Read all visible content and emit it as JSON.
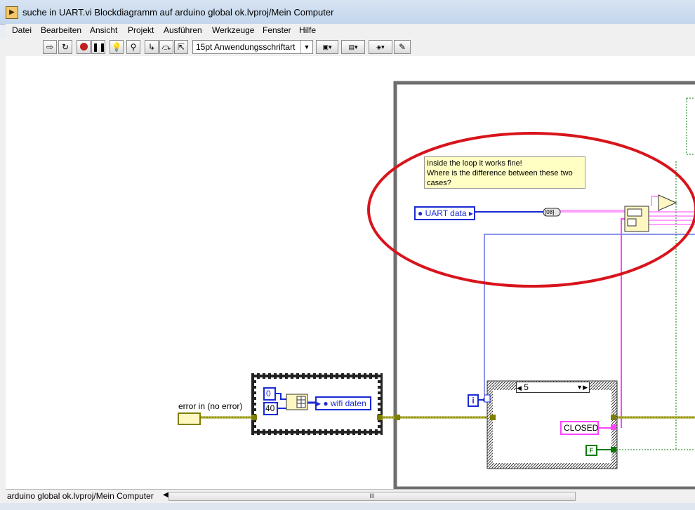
{
  "window": {
    "title": "suche in UART.vi Blockdiagramm auf arduino global ok.lvproj/Mein Computer",
    "app_icon": "labview-vi-icon"
  },
  "menu": [
    "Datei",
    "Bearbeiten",
    "Ansicht",
    "Projekt",
    "Ausführen",
    "Werkzeuge",
    "Fenster",
    "Hilfe"
  ],
  "toolbar": {
    "buttons": [
      "run-arrow-icon",
      "run-continuously-icon",
      "abort-icon",
      "pause-icon",
      "highlight-execution-icon",
      "retain-wire-values-icon",
      "step-into-icon",
      "step-over-icon",
      "step-out-icon"
    ],
    "font_selector": "15pt Anwendungsschriftart",
    "extra_buttons": [
      "align-objects-icon",
      "distribute-objects-icon",
      "reorder-icon",
      "clean-up-diagram-icon"
    ]
  },
  "diagram": {
    "comment": [
      "Inside the loop it works fine!",
      "Where is the difference between these two",
      "cases?"
    ],
    "uart_data_label": "UART data",
    "error_in_label": "error in (no error)",
    "const_0": "0",
    "const_40": "40",
    "wifi_daten_label": "wifi daten",
    "iteration_terminal": "i",
    "case_selector": "5",
    "closed_string": "CLOSED",
    "false_constant": "F",
    "tbd_label": "[08]",
    "colors": {
      "error_wire": "#8b8b00",
      "string_wire": "#ff44ff",
      "numeric_wire": "#1a2ad4",
      "boolean_wire": "#0a7a0a",
      "annotation_circle": "#d8141c"
    }
  },
  "statusbar": {
    "project_path": "arduino global ok.lvproj/Mein Computer",
    "scroll_grip": "III"
  }
}
